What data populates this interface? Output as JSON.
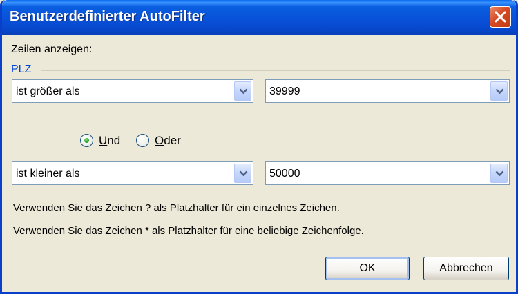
{
  "window": {
    "title": "Benutzerdefinierter AutoFilter"
  },
  "dialog": {
    "show_rows_label": "Zeilen anzeigen:",
    "field_name": "PLZ",
    "condition1": {
      "operator": "ist größer als",
      "value": "39999"
    },
    "logic": {
      "and_label": "Und",
      "and_mnemonic": "U",
      "and_rest": "nd",
      "or_label": "Oder",
      "or_mnemonic": "O",
      "or_rest": "der",
      "selected": "Und"
    },
    "condition2": {
      "operator": "ist kleiner als",
      "value": "50000"
    },
    "hint1": "Verwenden Sie das Zeichen ? als Platzhalter für ein einzelnes Zeichen.",
    "hint2": "Verwenden Sie das Zeichen * als Platzhalter für eine beliebige Zeichenfolge."
  },
  "buttons": {
    "ok": "OK",
    "cancel": "Abbrechen"
  },
  "colors": {
    "titlebar": "#0850d8",
    "window_bg": "#ece9d8",
    "group_label": "#0046d5",
    "close_button": "#d64a22"
  },
  "icons": {
    "close": "close-icon",
    "dropdown": "chevron-down-icon"
  }
}
